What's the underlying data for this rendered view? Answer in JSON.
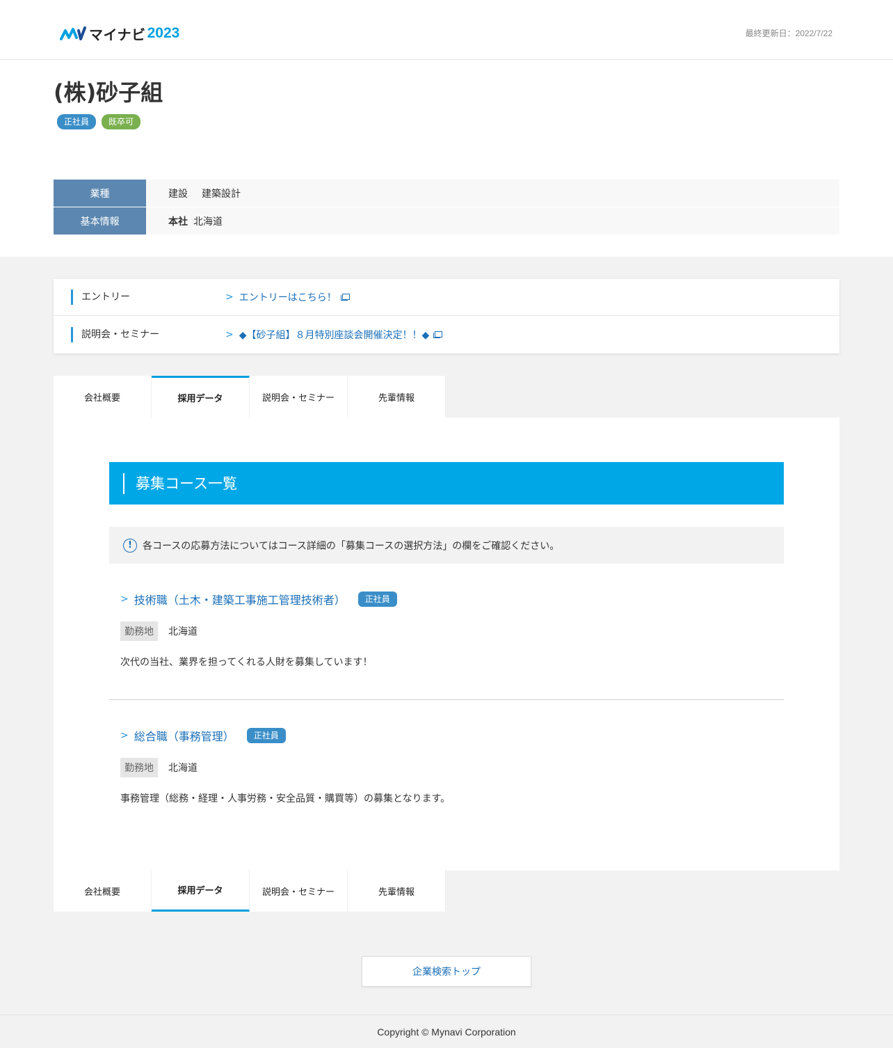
{
  "header": {
    "logo_kana": "マイナビ",
    "logo_year": "2023",
    "updated": "最終更新日：2022/7/22"
  },
  "company": {
    "name": "(株)砂子組",
    "badges": [
      "正社員",
      "既卒可"
    ]
  },
  "info": {
    "industry_label": "業種",
    "industry_values": [
      "建設",
      "建築設計"
    ],
    "basic_label": "基本情報",
    "hq_label": "本社",
    "hq_value": "北海道"
  },
  "entry": {
    "rows": [
      {
        "label": "エントリー",
        "link": "エントリーはこちら！"
      },
      {
        "label": "説明会・セミナー",
        "link": "◆【砂子組】８月特別座談会開催決定！！◆"
      }
    ]
  },
  "tabs": [
    {
      "label": "会社概要"
    },
    {
      "label": "採用データ"
    },
    {
      "label": "説明会・セミナー"
    },
    {
      "label": "先輩情報"
    }
  ],
  "main": {
    "section_title": "募集コース一覧",
    "notice": "各コースの応募方法についてはコース詳細の「募集コースの選択方法」の欄をご確認ください。",
    "courses": [
      {
        "title": "技術職（土木・建築工事施工管理技術者）",
        "badge": "正社員",
        "loc_label": "勤務地",
        "loc_value": "北海道",
        "desc": "次代の当社、業界を担ってくれる人財を募集しています！"
      },
      {
        "title": "総合職（事務管理）",
        "badge": "正社員",
        "loc_label": "勤務地",
        "loc_value": "北海道",
        "desc": "事務管理（総務・経理・人事労務・安全品質・購買等）の募集となります。"
      }
    ]
  },
  "button": {
    "label": "企業検索トップ"
  },
  "footer": {
    "copyright": "Copyright © Mynavi Corporation"
  },
  "colors": {
    "accent": "#00a7e6",
    "link": "#1a6fb8",
    "table_header": "#5b87b0",
    "badge_blue": "#3a8ec8",
    "badge_green": "#7ab04e"
  }
}
